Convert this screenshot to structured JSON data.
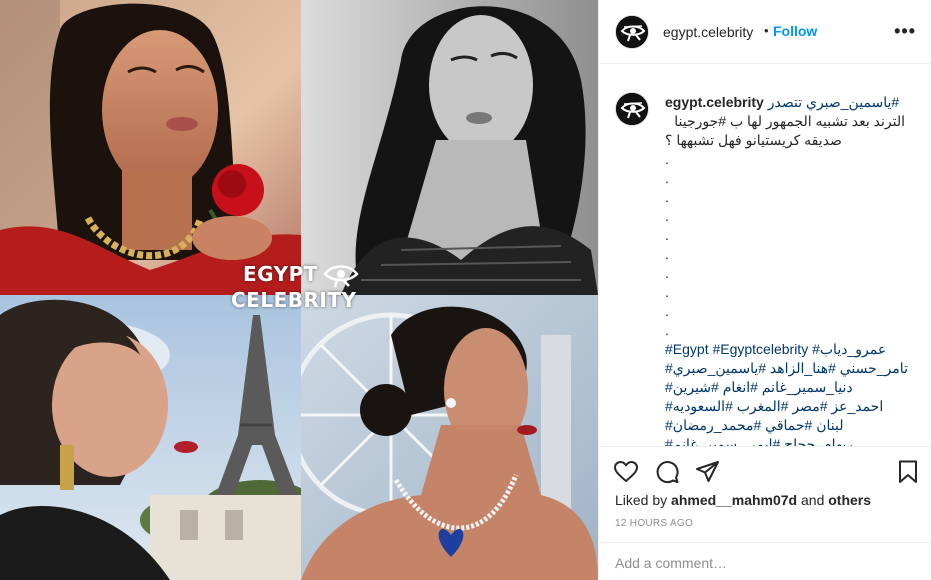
{
  "post": {
    "watermark": {
      "line1": "EGYPT",
      "line2": "CELEBRITY"
    },
    "photos": [
      {
        "name": "photo-woman-red-rose"
      },
      {
        "name": "photo-woman-black-white"
      },
      {
        "name": "photo-woman-eiffel-tower"
      },
      {
        "name": "photo-woman-blue-heart-necklace"
      }
    ]
  },
  "header": {
    "username": "egypt.celebrity",
    "separator": "•",
    "follow_label": "Follow",
    "more_icon": "more-options-icon",
    "more_label": "•••"
  },
  "caption": {
    "username": "egypt.celebrity",
    "line1": "#ياسمين_صبري تتصدر",
    "line2": "الترند بعد تشبيه الجمهور لها ب #جورجينا",
    "line3": "صديقه كريستيانو فهل تشبهها ؟",
    "dots": [
      ".",
      ".",
      ".",
      ".",
      ".",
      ".",
      ".",
      ".",
      ".",
      "."
    ],
    "hashtag_lines": [
      "#Egypt #Egyptcelebrity #عمرو_دياب",
      "#تامر_حسني #هنا_الزاهد #ياسمين_صبري",
      "#دنيا_سمير_غانم #انغام #شيرين",
      "#احمد_عز #مصر #المغرب #السعوديه",
      "#لبنان #حماقي #محمد_رمضان",
      "#ريهام_حجاج #ايمي_سمير_غانم"
    ]
  },
  "actions": {
    "icons": [
      "heart-icon",
      "comment-icon",
      "share-icon",
      "bookmark-icon"
    ],
    "liked_prefix": "Liked by",
    "liked_user": "ahmed__mahm07d",
    "liked_and": "and",
    "liked_others": "others",
    "time": "12 HOURS AGO"
  },
  "comment_box": {
    "placeholder": "Add a comment…"
  },
  "colors": {
    "accent": "#0095f6",
    "hashtag": "#00376b",
    "muted": "#8e8e8e",
    "border": "#efefef"
  }
}
